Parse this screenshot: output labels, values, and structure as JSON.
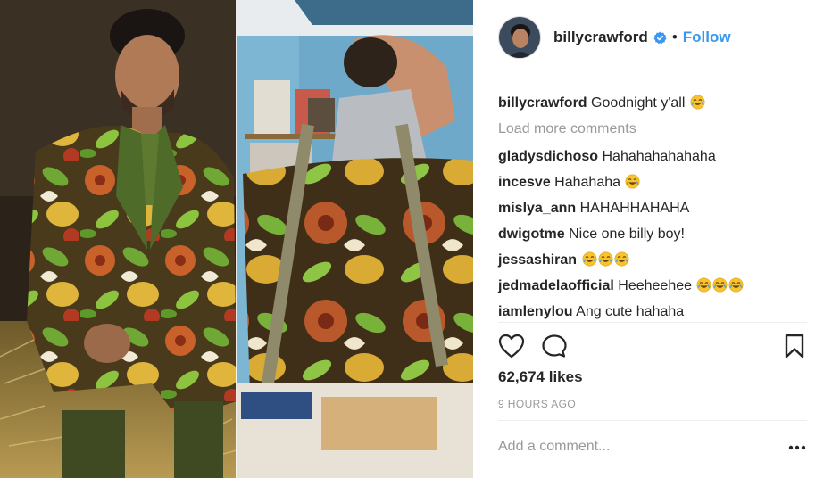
{
  "post": {
    "username": "billycrawford",
    "separator": "•",
    "follow_label": "Follow",
    "caption": {
      "user": "billycrawford",
      "text": "Goodnight y'all",
      "emoji": "face-with-tears-of-joy"
    },
    "load_more_label": "Load more comments",
    "comments": [
      {
        "user": "gladysdichoso",
        "text": "Hahahahahahaha",
        "emoji_count": 0
      },
      {
        "user": "incesve",
        "text": "Hahahaha",
        "emoji_count": 1
      },
      {
        "user": "mislya_ann",
        "text": "HAHAHHAHAHA",
        "emoji_count": 0
      },
      {
        "user": "dwigotme",
        "text": "Nice one billy boy!",
        "emoji_count": 0
      },
      {
        "user": "jessashiran",
        "text": "",
        "emoji_count": 3
      },
      {
        "user": "jedmadelaofficial",
        "text": "Heeheehee",
        "emoji_count": 3
      },
      {
        "user": "iamlenylou",
        "text": "Ang cute hahaha",
        "emoji_count": 0
      }
    ],
    "likes": "62,674 likes",
    "time_ago": "9 HOURS AGO",
    "add_comment_placeholder": "Add a comment...",
    "icons": [
      "heart-icon",
      "comment-icon",
      "bookmark-icon",
      "more-options-icon",
      "verified-badge-icon"
    ]
  },
  "colors": {
    "link_blue": "#3897f0",
    "muted_text": "#999999",
    "primary_text": "#262626",
    "divider": "#efefef"
  }
}
